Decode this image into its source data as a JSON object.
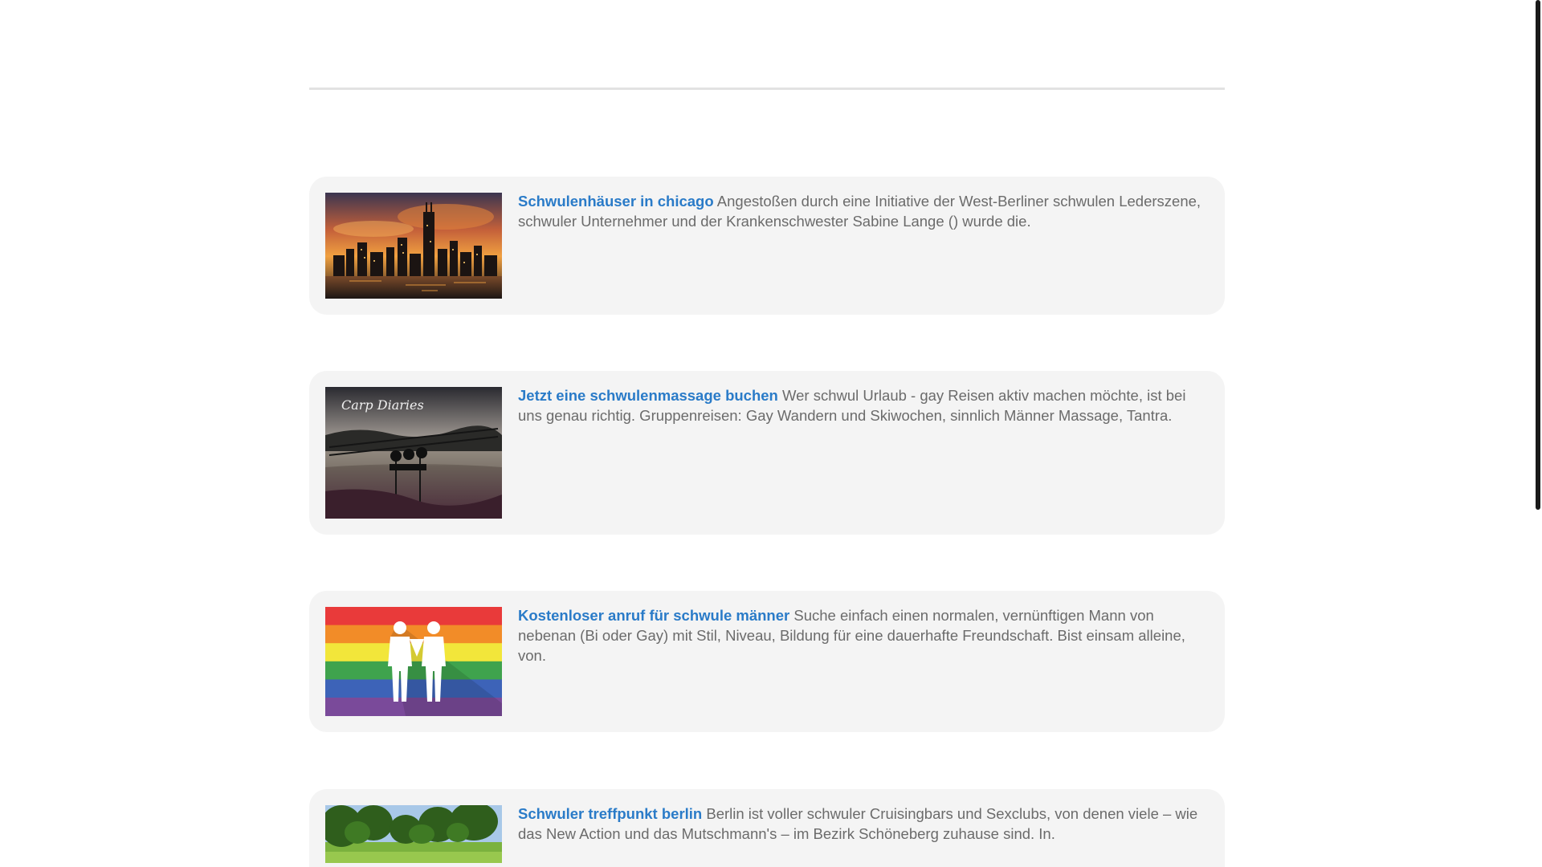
{
  "articles": [
    {
      "title": "Schwulenhäuser in chicago",
      "description": "Angestoßen durch eine Initiative der West-Berliner schwulen Lederszene, schwuler Unternehmer und der Krankenschwester Sabine Lange () wurde die.",
      "image": "chicago-skyline-sunset"
    },
    {
      "title": "Jetzt eine schwulenmassage buchen",
      "description": "Wer schwul Urlaub - gay Reisen aktiv machen möchte, ist bei uns genau richtig. Gruppenreisen: Gay Wandern und Skiwochen, sinnlich Männer Massage, Tantra.",
      "image": "carp-fishing-rods-lake",
      "image_caption": "Carp Diaries"
    },
    {
      "title": "Kostenloser anruf für schwule männer",
      "description": "Suche einfach einen normalen, vernünftigen Mann von nebenan (Bi oder Gay) mit Stil, Niveau, Bildung für eine dauerhafte Freundschaft. Bist einsam alleine, von.",
      "image": "rainbow-flag-two-men",
      "flag_colors": [
        "#e93a3a",
        "#f28c28",
        "#f2e63a",
        "#3fa34d",
        "#3d63b8",
        "#7a4a9a"
      ]
    },
    {
      "title": "Schwuler treffpunkt berlin",
      "description": "Berlin ist voller schwuler Cruisingbars und Sexclubs, von denen viele – wie das New Action und das Mutschmann's – im Bezirk Schöneberg zuhause sind. In.",
      "image": "green-park-trees"
    }
  ],
  "colors": {
    "link": "#2a7bc8",
    "text": "#6b6b6b",
    "card_bg": "#f4f4f4"
  }
}
